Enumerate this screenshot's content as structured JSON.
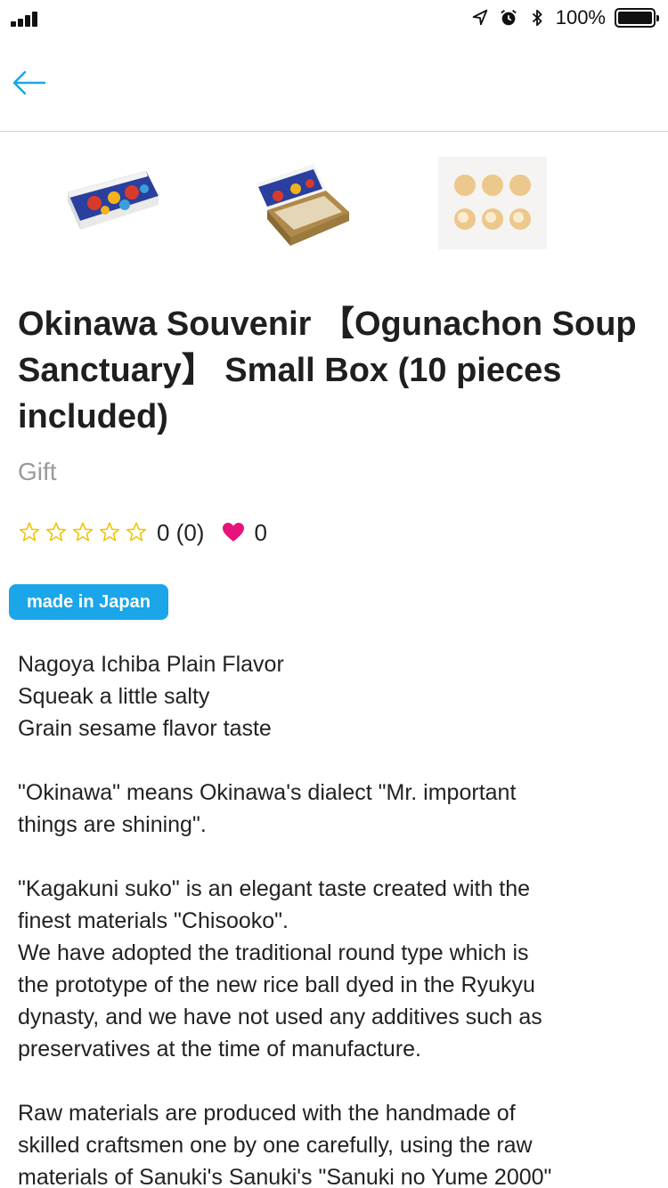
{
  "status_bar": {
    "battery_percent": "100%",
    "icons": [
      "signal-icon",
      "location-arrow-icon",
      "alarm-icon",
      "bluetooth-icon",
      "battery-icon"
    ]
  },
  "nav": {
    "back_icon": "arrow-left-icon",
    "accent_color": "#1aa6e8"
  },
  "product": {
    "images": [
      "product-image-box-closed",
      "product-image-box-open",
      "product-image-cookies"
    ],
    "title": "Okinawa Souvenir 【Ogunachon Soup Sanctuary】 Small Box (10 pieces included)",
    "category": "Gift",
    "rating_stars": 0,
    "rating_text": "0 (0)",
    "likes": "0",
    "tag": "made in Japan",
    "tag_color": "#1aa6e8",
    "heart_color": "#e8137a"
  },
  "description": {
    "p1": [
      "Nagoya Ichiba Plain Flavor",
      "Squeak a little salty",
      "Grain sesame flavor taste"
    ],
    "p2": [
      "\"Okinawa\" means Okinawa's dialect \"Mr. important",
      "things are shining\"."
    ],
    "p3": [
      "\"Kagakuni suko\" is an elegant taste created with the",
      "finest materials \"Chisooko\".",
      "We have adopted the traditional round type which is",
      "the prototype of the new rice ball dyed in the Ryukyu",
      "dynasty, and we have not used any additives such as",
      "preservatives at the time of manufacture."
    ],
    "p4": [
      "Raw materials are produced with the handmade of",
      "skilled craftsmen one by one carefully, using the raw",
      "materials of Sanuki's Sanuki's \"Sanuki no Yume 2000\""
    ]
  }
}
